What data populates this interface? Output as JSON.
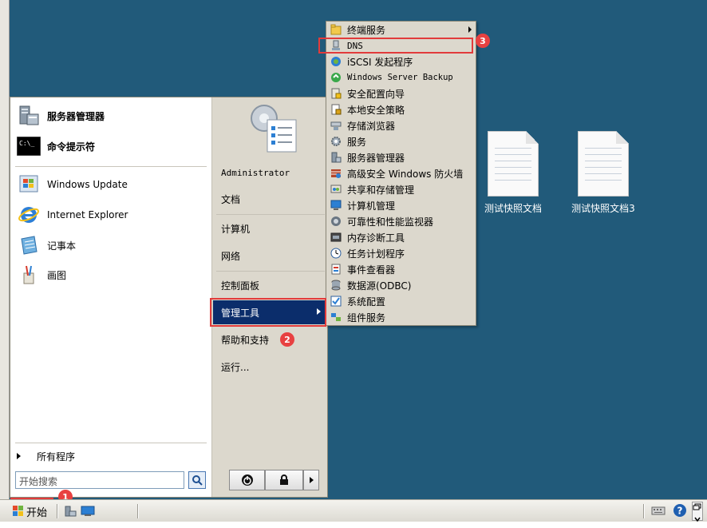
{
  "desktop": {
    "icons": [
      {
        "label": "测试快照文档"
      },
      {
        "label": "测试快照文档3"
      }
    ]
  },
  "start_menu": {
    "pinned": [
      {
        "label": "服务器管理器",
        "icon": "server-manager-icon"
      },
      {
        "label": "命令提示符",
        "icon": "cmd-icon"
      }
    ],
    "recent": [
      {
        "label": "Windows Update",
        "icon": "windows-update-icon"
      },
      {
        "label": "Internet Explorer",
        "icon": "ie-icon"
      },
      {
        "label": "记事本",
        "icon": "notepad-icon"
      },
      {
        "label": "画图",
        "icon": "paint-icon"
      }
    ],
    "all_programs": "所有程序",
    "search_placeholder": "开始搜索",
    "right": {
      "user": "Administrator",
      "documents": "文档",
      "computer": "计算机",
      "network": "网络",
      "control_panel": "控制面板",
      "admin_tools": "管理工具",
      "help": "帮助和支持",
      "run": "运行..."
    }
  },
  "admin_tools_menu": {
    "items": [
      {
        "label": "终端服务",
        "icon": "folder-icon",
        "submenu": true
      },
      {
        "label": "DNS",
        "icon": "dns-icon"
      },
      {
        "label": "iSCSI 发起程序",
        "icon": "iscsi-icon"
      },
      {
        "label": "Windows Server Backup",
        "icon": "backup-icon"
      },
      {
        "label": "安全配置向导",
        "icon": "security-wizard-icon"
      },
      {
        "label": "本地安全策略",
        "icon": "local-policy-icon"
      },
      {
        "label": "存储浏览器",
        "icon": "storage-explorer-icon"
      },
      {
        "label": "服务",
        "icon": "services-icon"
      },
      {
        "label": "服务器管理器",
        "icon": "server-manager-icon"
      },
      {
        "label": "高级安全 Windows 防火墙",
        "icon": "firewall-icon"
      },
      {
        "label": "共享和存储管理",
        "icon": "share-storage-icon"
      },
      {
        "label": "计算机管理",
        "icon": "computer-management-icon"
      },
      {
        "label": "可靠性和性能监视器",
        "icon": "reliability-monitor-icon"
      },
      {
        "label": "内存诊断工具",
        "icon": "memory-diagnostic-icon"
      },
      {
        "label": "任务计划程序",
        "icon": "task-scheduler-icon"
      },
      {
        "label": "事件查看器",
        "icon": "event-viewer-icon"
      },
      {
        "label": "数据源(ODBC)",
        "icon": "odbc-icon"
      },
      {
        "label": "系统配置",
        "icon": "system-config-icon"
      },
      {
        "label": "组件服务",
        "icon": "component-services-icon"
      }
    ]
  },
  "annotations": {
    "badge1": "1",
    "badge2": "2",
    "badge3": "3",
    "color": "#e23b3b"
  },
  "taskbar": {
    "start_label": "开始"
  }
}
